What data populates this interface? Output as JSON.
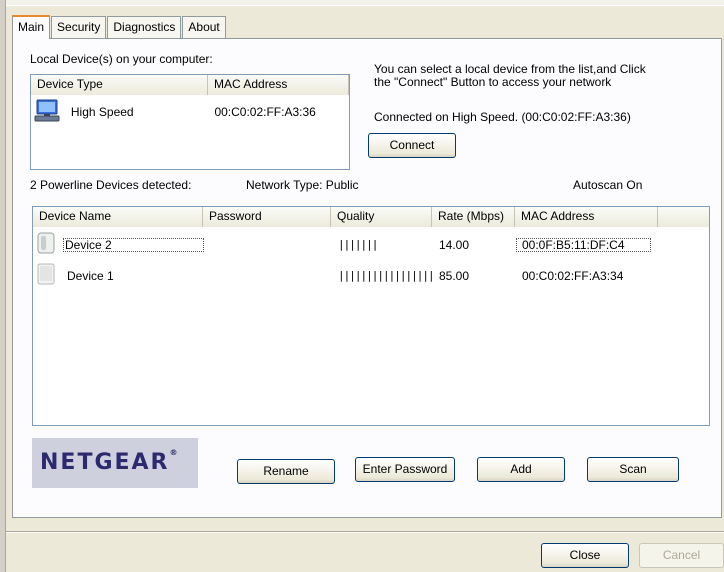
{
  "tabs": [
    "Main",
    "Security",
    "Diagnostics",
    "About"
  ],
  "local_devices": {
    "label": "Local Device(s) on your computer:",
    "columns": [
      "Device Type",
      "MAC Address"
    ],
    "rows": [
      {
        "type": "High Speed",
        "mac": "00:C0:02:FF:A3:36",
        "icon": "computer-icon"
      }
    ]
  },
  "info": {
    "line1": "You can select a local device from the list,and Click",
    "line2": "the \"Connect\" Button to access your network",
    "connected": "Connected on  High Speed. (00:C0:02:FF:A3:36)"
  },
  "connect_label": "Connect",
  "status": {
    "detected": "2 Powerline Devices detected:",
    "network_type": "Network Type: Public",
    "autoscan": "Autoscan On"
  },
  "powerline": {
    "columns": [
      "Device Name",
      "Password",
      "Quality",
      "Rate (Mbps)",
      "MAC Address"
    ],
    "rows": [
      {
        "name": "Device 2",
        "password": "",
        "quality": "|||||||",
        "rate": "14.00",
        "mac": "00:0F:B5:11:DF:C4",
        "icon": "powerline-adapter-icon",
        "selected": true
      },
      {
        "name": "Device 1",
        "password": "",
        "quality": "||||||||||||||||||||||||||...",
        "rate": "85.00",
        "mac": "00:C0:02:FF:A3:34",
        "icon": "powerline-adapter-icon",
        "selected": false
      }
    ]
  },
  "logo": {
    "text": "NETGEAR",
    "mark": "®"
  },
  "buttons": {
    "rename": "Rename",
    "enter_password": "Enter Password",
    "add": "Add",
    "scan": "Scan",
    "close": "Close",
    "cancel": "Cancel"
  },
  "colors": {
    "tab_accent": "#e68b2c",
    "list_border": "#7f9db9",
    "logo_bg": "#cfd0de",
    "logo_text": "#2b2a6f"
  }
}
